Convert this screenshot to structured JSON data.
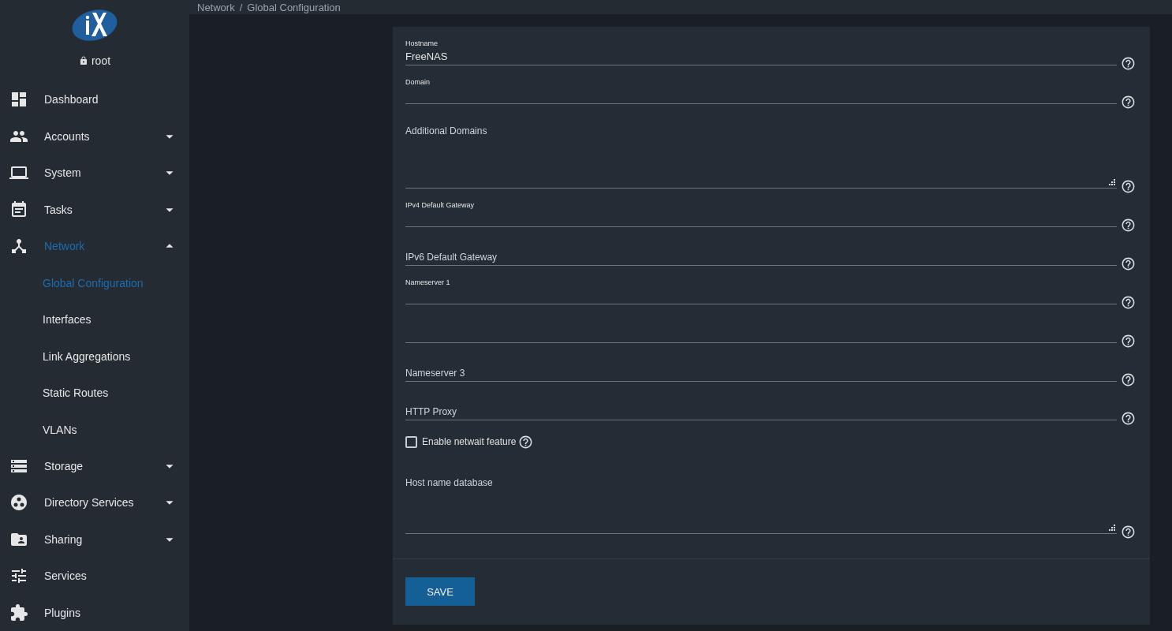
{
  "breadcrumb": {
    "parent": "Network",
    "separator": "/",
    "current": "Global Configuration"
  },
  "sidebar": {
    "user": "root",
    "items": [
      {
        "label": "Dashboard",
        "selected": false
      },
      {
        "label": "Accounts",
        "selected": false,
        "expanded": false
      },
      {
        "label": "System",
        "selected": false,
        "expanded": false
      },
      {
        "label": "Tasks",
        "selected": false,
        "expanded": false
      },
      {
        "label": "Network",
        "selected": true,
        "expanded": true,
        "children": [
          {
            "label": "Global Configuration",
            "selected": true
          },
          {
            "label": "Interfaces",
            "selected": false
          },
          {
            "label": "Link Aggregations",
            "selected": false
          },
          {
            "label": "Static Routes",
            "selected": false
          },
          {
            "label": "VLANs",
            "selected": false
          }
        ]
      },
      {
        "label": "Storage",
        "selected": false,
        "expanded": false
      },
      {
        "label": "Directory Services",
        "selected": false,
        "expanded": false
      },
      {
        "label": "Sharing",
        "selected": false,
        "expanded": false
      },
      {
        "label": "Services",
        "selected": false
      },
      {
        "label": "Plugins",
        "selected": false
      }
    ]
  },
  "form": {
    "fields": [
      {
        "kind": "input",
        "label": "Hostname",
        "value": "FreeNAS"
      },
      {
        "kind": "input",
        "label": "Domain"
      },
      {
        "kind": "textarea",
        "placeholder": "Additional Domains"
      },
      {
        "kind": "input",
        "label": "IPv4 Default Gateway"
      },
      {
        "kind": "input",
        "placeholder": "IPv6 Default Gateway"
      },
      {
        "kind": "input",
        "label": "Nameserver 1"
      },
      {
        "kind": "input"
      },
      {
        "kind": "input",
        "placeholder": "Nameserver 3"
      },
      {
        "kind": "input",
        "placeholder": "HTTP Proxy"
      },
      {
        "kind": "checkbox",
        "label": "Enable netwait feature",
        "checked": false
      },
      {
        "kind": "textarea",
        "placeholder": "Host name database"
      }
    ],
    "save_button": "SAVE"
  }
}
